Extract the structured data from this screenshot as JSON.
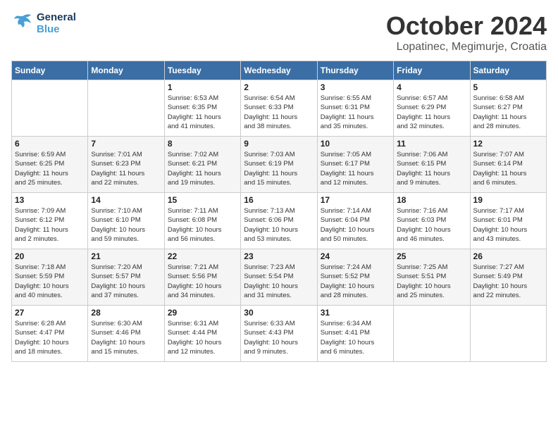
{
  "header": {
    "logo_line1": "General",
    "logo_line2": "Blue",
    "month": "October 2024",
    "location": "Lopatinec, Megimurje, Croatia"
  },
  "weekdays": [
    "Sunday",
    "Monday",
    "Tuesday",
    "Wednesday",
    "Thursday",
    "Friday",
    "Saturday"
  ],
  "weeks": [
    [
      {
        "day": "",
        "info": ""
      },
      {
        "day": "",
        "info": ""
      },
      {
        "day": "1",
        "info": "Sunrise: 6:53 AM\nSunset: 6:35 PM\nDaylight: 11 hours\nand 41 minutes."
      },
      {
        "day": "2",
        "info": "Sunrise: 6:54 AM\nSunset: 6:33 PM\nDaylight: 11 hours\nand 38 minutes."
      },
      {
        "day": "3",
        "info": "Sunrise: 6:55 AM\nSunset: 6:31 PM\nDaylight: 11 hours\nand 35 minutes."
      },
      {
        "day": "4",
        "info": "Sunrise: 6:57 AM\nSunset: 6:29 PM\nDaylight: 11 hours\nand 32 minutes."
      },
      {
        "day": "5",
        "info": "Sunrise: 6:58 AM\nSunset: 6:27 PM\nDaylight: 11 hours\nand 28 minutes."
      }
    ],
    [
      {
        "day": "6",
        "info": "Sunrise: 6:59 AM\nSunset: 6:25 PM\nDaylight: 11 hours\nand 25 minutes."
      },
      {
        "day": "7",
        "info": "Sunrise: 7:01 AM\nSunset: 6:23 PM\nDaylight: 11 hours\nand 22 minutes."
      },
      {
        "day": "8",
        "info": "Sunrise: 7:02 AM\nSunset: 6:21 PM\nDaylight: 11 hours\nand 19 minutes."
      },
      {
        "day": "9",
        "info": "Sunrise: 7:03 AM\nSunset: 6:19 PM\nDaylight: 11 hours\nand 15 minutes."
      },
      {
        "day": "10",
        "info": "Sunrise: 7:05 AM\nSunset: 6:17 PM\nDaylight: 11 hours\nand 12 minutes."
      },
      {
        "day": "11",
        "info": "Sunrise: 7:06 AM\nSunset: 6:15 PM\nDaylight: 11 hours\nand 9 minutes."
      },
      {
        "day": "12",
        "info": "Sunrise: 7:07 AM\nSunset: 6:14 PM\nDaylight: 11 hours\nand 6 minutes."
      }
    ],
    [
      {
        "day": "13",
        "info": "Sunrise: 7:09 AM\nSunset: 6:12 PM\nDaylight: 11 hours\nand 2 minutes."
      },
      {
        "day": "14",
        "info": "Sunrise: 7:10 AM\nSunset: 6:10 PM\nDaylight: 10 hours\nand 59 minutes."
      },
      {
        "day": "15",
        "info": "Sunrise: 7:11 AM\nSunset: 6:08 PM\nDaylight: 10 hours\nand 56 minutes."
      },
      {
        "day": "16",
        "info": "Sunrise: 7:13 AM\nSunset: 6:06 PM\nDaylight: 10 hours\nand 53 minutes."
      },
      {
        "day": "17",
        "info": "Sunrise: 7:14 AM\nSunset: 6:04 PM\nDaylight: 10 hours\nand 50 minutes."
      },
      {
        "day": "18",
        "info": "Sunrise: 7:16 AM\nSunset: 6:03 PM\nDaylight: 10 hours\nand 46 minutes."
      },
      {
        "day": "19",
        "info": "Sunrise: 7:17 AM\nSunset: 6:01 PM\nDaylight: 10 hours\nand 43 minutes."
      }
    ],
    [
      {
        "day": "20",
        "info": "Sunrise: 7:18 AM\nSunset: 5:59 PM\nDaylight: 10 hours\nand 40 minutes."
      },
      {
        "day": "21",
        "info": "Sunrise: 7:20 AM\nSunset: 5:57 PM\nDaylight: 10 hours\nand 37 minutes."
      },
      {
        "day": "22",
        "info": "Sunrise: 7:21 AM\nSunset: 5:56 PM\nDaylight: 10 hours\nand 34 minutes."
      },
      {
        "day": "23",
        "info": "Sunrise: 7:23 AM\nSunset: 5:54 PM\nDaylight: 10 hours\nand 31 minutes."
      },
      {
        "day": "24",
        "info": "Sunrise: 7:24 AM\nSunset: 5:52 PM\nDaylight: 10 hours\nand 28 minutes."
      },
      {
        "day": "25",
        "info": "Sunrise: 7:25 AM\nSunset: 5:51 PM\nDaylight: 10 hours\nand 25 minutes."
      },
      {
        "day": "26",
        "info": "Sunrise: 7:27 AM\nSunset: 5:49 PM\nDaylight: 10 hours\nand 22 minutes."
      }
    ],
    [
      {
        "day": "27",
        "info": "Sunrise: 6:28 AM\nSunset: 4:47 PM\nDaylight: 10 hours\nand 18 minutes."
      },
      {
        "day": "28",
        "info": "Sunrise: 6:30 AM\nSunset: 4:46 PM\nDaylight: 10 hours\nand 15 minutes."
      },
      {
        "day": "29",
        "info": "Sunrise: 6:31 AM\nSunset: 4:44 PM\nDaylight: 10 hours\nand 12 minutes."
      },
      {
        "day": "30",
        "info": "Sunrise: 6:33 AM\nSunset: 4:43 PM\nDaylight: 10 hours\nand 9 minutes."
      },
      {
        "day": "31",
        "info": "Sunrise: 6:34 AM\nSunset: 4:41 PM\nDaylight: 10 hours\nand 6 minutes."
      },
      {
        "day": "",
        "info": ""
      },
      {
        "day": "",
        "info": ""
      }
    ]
  ]
}
